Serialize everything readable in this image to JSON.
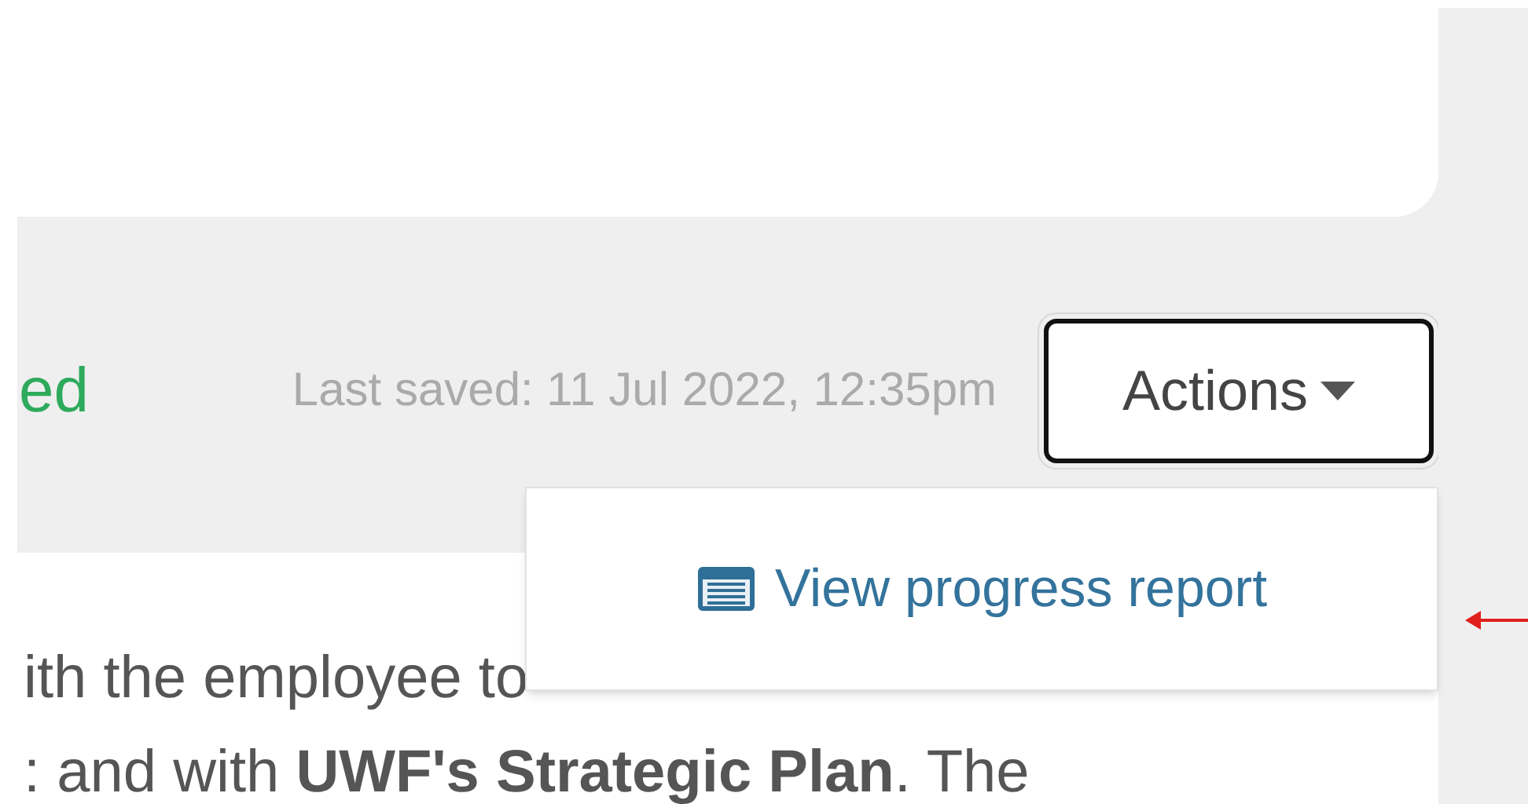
{
  "status": {
    "state_text": "ed",
    "last_saved": "Last saved: 11 Jul 2022, 12:35pm"
  },
  "actions_button": {
    "label": "Actions",
    "expanded": true
  },
  "menu": {
    "items": [
      {
        "label": "View progress report"
      }
    ]
  },
  "body": {
    "lines": [
      "ith the employee to",
      ": and with **UWF's Strategic Plan**. The"
    ]
  }
}
